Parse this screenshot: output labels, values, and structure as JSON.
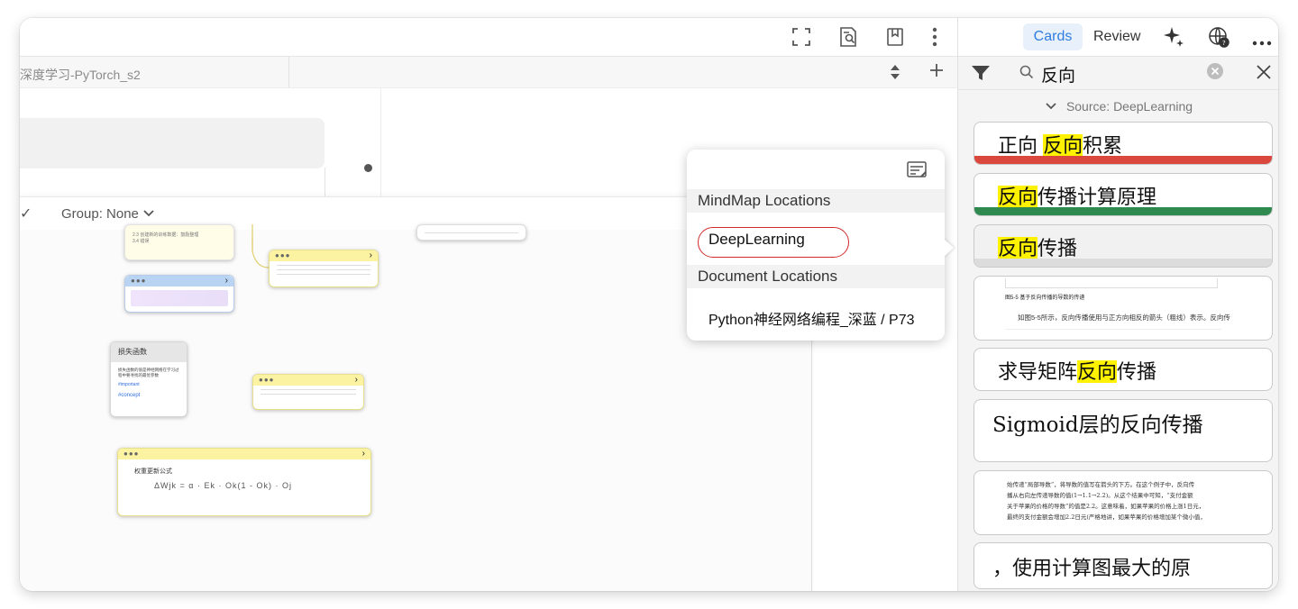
{
  "toolbar": {
    "icons": [
      "fullscreen-icon",
      "document-search-icon",
      "bookmark-icon",
      "more-vertical-icon"
    ]
  },
  "tab": {
    "title": "深度学习-PyTorch_s2"
  },
  "canvas": {
    "group_label": "Group: None",
    "nodes": {
      "toc_item_1": "2.3   创建新的训练数据：鼓励整理",
      "toc_item_2": "3.4   错误",
      "loss_title": "损失函数",
      "loss_body": "损失函数的值是神经网络在学习过程中要寻找的最优参数",
      "loss_tag1": "#important",
      "loss_tag2": "#concept",
      "weight_title": "权重更新公式",
      "weight_formula": "ΔWjk  =   α  ·  Ek  ·  Ok(1 - Ok)  ·  Oj"
    }
  },
  "sidebar": {
    "tabs": {
      "cards": "Cards",
      "review": "Review"
    },
    "icons": [
      "ai-sparkle-icon",
      "web-help-icon",
      "more-horizontal-icon"
    ],
    "search": {
      "query": "反向"
    },
    "source_label": "Source: DeepLearning",
    "cards": [
      {
        "before": "正向 ",
        "match": "反向",
        "after": "积累",
        "stripe": "#d9473d"
      },
      {
        "before": "",
        "match": "反向",
        "after": "传播计算原理",
        "stripe": "#2f8a4f"
      },
      {
        "before": "",
        "match": "反向",
        "after": "传播",
        "stripe": "#dcdcdc"
      },
      {
        "scan_caption": "图5-5  基于反向传播的导数的传递",
        "scan_body": "如图5-5所示，反向传播使用与正方向相反的箭头（粗线）表示。反向传"
      },
      {
        "before": "求导矩阵",
        "match": "反向",
        "after": "传播"
      },
      {
        "serif_text": "Sigmoid层的反向传播"
      },
      {
        "scan_lines": [
          "始传递“局部导数”，将导数的值写在箭头的下方。在这个例子中，反向传",
          "播从右向左传递导数的值(1→1.1→2.2)。从这个结果中可知，“支付金额",
          "关于苹果的价格的导数”的值是2.2。这意味着，如果苹果的价格上涨1日元，",
          "最终的支付金额会增加2.2日元(严格地讲，如果苹果的价格增加某个微小值，"
        ]
      },
      {
        "plain_text": "，使用计算图最大的原"
      }
    ]
  },
  "popup": {
    "mindmap_header": "MindMap Locations",
    "mindmap_item": "DeepLearning",
    "document_header": "Document Locations",
    "document_item": "Python神经网络编程_深蓝 / P73"
  }
}
